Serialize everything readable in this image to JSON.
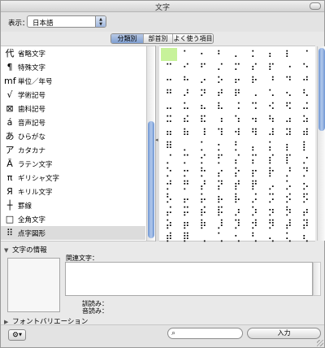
{
  "window": {
    "title": "文字"
  },
  "toolbar": {
    "show_label": "表示：",
    "language_value": "日本語"
  },
  "tabs": [
    {
      "label": "分類別",
      "active": true
    },
    {
      "label": "部首別",
      "active": false
    },
    {
      "label": "よく使う項目",
      "active": false
    }
  ],
  "categories": [
    {
      "icon": "代",
      "label": "省略文字",
      "selected": false
    },
    {
      "icon": "¶",
      "label": "特殊文字",
      "selected": false
    },
    {
      "icon": "mf",
      "label": "単位／年号",
      "selected": false
    },
    {
      "icon": "√",
      "label": "学術記号",
      "selected": false
    },
    {
      "icon": "⊠",
      "label": "歯科記号",
      "selected": false
    },
    {
      "icon": "á",
      "label": "音声記号",
      "selected": false
    },
    {
      "icon": "あ",
      "label": "ひらがな",
      "selected": false
    },
    {
      "icon": "ア",
      "label": "カタカナ",
      "selected": false
    },
    {
      "icon": "Ā",
      "label": "ラテン文字",
      "selected": false
    },
    {
      "icon": "π",
      "label": "ギリシャ文字",
      "selected": false
    },
    {
      "icon": "Я",
      "label": "キリル文字",
      "selected": false
    },
    {
      "icon": "┼",
      "label": "罫線",
      "selected": false
    },
    {
      "icon": "□",
      "label": "全角文字",
      "selected": false
    },
    {
      "icon": "⠿",
      "label": "点字図形",
      "selected": true
    }
  ],
  "braille_grid": [
    "⠀⠁⠂⠃⠄⠅⠆⠇⠈",
    "⠉⠊⠋⠌⠍⠎⠏⠐⠑",
    "⠒⠓⠔⠕⠖⠗⠘⠙⠚",
    "⠛⠜⠝⠞⠟⠠⠡⠢⠣",
    "⠤⠥⠦⠧⠨⠩⠪⠫⠬",
    "⠭⠮⠯⠰⠱⠲⠳⠴⠵",
    "⠶⠷⠸⠹⠺⠻⠼⠽⠾",
    "⠿⡀⡁⡂⡃⡄⡅⡆⡇",
    "⡈⡉⡊⡋⡌⡍⡎⡏⡐",
    "⡑⡒⡓⡔⡕⡖⡗⡘⡙",
    "⡚⡛⡜⡝⡞⡟⡠⡡⡢",
    "⡣⡤⡥⡦⡧⡨⡩⡪⡫",
    "⡬⡭⡮⡯⡰⡱⡲⡳⡴",
    "⡵⡶⡷⡸⡹⡺⡻⡼⡽",
    "⡾⡿⢀⢁⢂⢃⢄⢅⢆"
  ],
  "info": {
    "header": "文字の情報",
    "related_label": "関連文字：",
    "kun_label": "訓読み：",
    "on_label": "音読み："
  },
  "variation": {
    "label": "フォントバリエーション"
  },
  "bottom": {
    "insert_label": "入力",
    "search_placeholder": ""
  },
  "colors": {
    "selected_cell": "#c7f29a",
    "scroll_thumb": "#7f9fd1"
  }
}
